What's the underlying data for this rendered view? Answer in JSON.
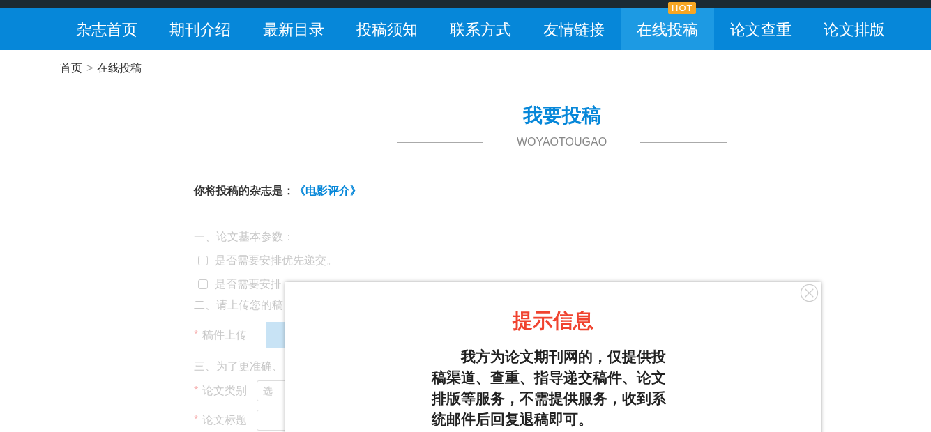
{
  "nav": {
    "items": [
      {
        "label": "杂志首页",
        "selected": false
      },
      {
        "label": "期刊介绍",
        "selected": false
      },
      {
        "label": "最新目录",
        "selected": false
      },
      {
        "label": "投稿须知",
        "selected": false
      },
      {
        "label": "联系方式",
        "selected": false
      },
      {
        "label": "友情链接",
        "selected": false
      },
      {
        "label": "在线投稿",
        "selected": true,
        "badge": "HOT"
      },
      {
        "label": "论文查重",
        "selected": false
      },
      {
        "label": "论文排版",
        "selected": false
      }
    ]
  },
  "breadcrumb": {
    "home": "首页",
    "separator": ">",
    "current": "在线投稿"
  },
  "heading": {
    "title": "我要投稿",
    "subtitle": "WOYAOTOUGAO"
  },
  "journal": {
    "label": "你将投稿的杂志是：",
    "name": "《电影评介》"
  },
  "form": {
    "section_1": "一、论文基本参数：",
    "checkboxes": [
      {
        "label": "是否需要安排优先递交。",
        "checked": false
      },
      {
        "label": "是否需要安排",
        "checked": false
      }
    ],
    "section_2": "二、请上传您的稿",
    "upload": {
      "required": "*",
      "label": "稿件上传"
    },
    "section_3": "三、为了更准确、",
    "category": {
      "required": "*",
      "label": "论文类别",
      "placeholder": "选"
    },
    "title": {
      "required": "*",
      "label": "论文标题"
    }
  },
  "dialog": {
    "title": "提示信息",
    "message": "我方为论文期刊网的，仅提供投稿渠道、查重、指导递交稿件、论文排版等服务，不需提供服务，收到系统邮件后回复退稿即可。"
  }
}
